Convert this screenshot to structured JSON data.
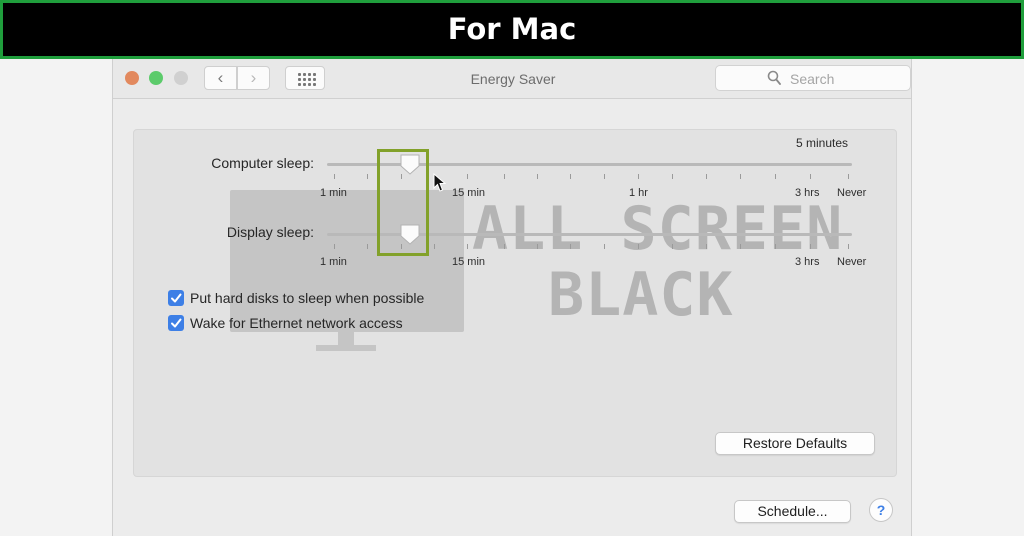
{
  "banner": {
    "title": "For Mac"
  },
  "window": {
    "title": "Energy Saver",
    "search_placeholder": "Search",
    "nav": {
      "back_glyph": "‹",
      "forward_glyph": "›"
    }
  },
  "sliders": {
    "computer_sleep": {
      "label": "Computer sleep:",
      "value_text": "5 minutes",
      "value_fraction": 0.148,
      "tick_labels": {
        "min": "1 min",
        "q": "15 min",
        "hr": "1 hr",
        "three": "3 hrs",
        "never": "Never"
      }
    },
    "display_sleep": {
      "label": "Display sleep:",
      "value_fraction": 0.148,
      "tick_labels": {
        "min": "1 min",
        "q": "15 min",
        "three": "3 hrs",
        "never": "Never"
      }
    }
  },
  "options": {
    "hard_disks": {
      "label": "Put hard disks to sleep when possible",
      "checked": true
    },
    "ethernet": {
      "label": "Wake for Ethernet network access",
      "checked": true
    }
  },
  "buttons": {
    "restore": "Restore Defaults",
    "schedule": "Schedule...",
    "help": "?"
  },
  "watermark": {
    "line1": "ALL SCREEN",
    "line2": "BLACK"
  },
  "icons": [
    "close-light",
    "minimize-light",
    "zoom-light",
    "back-icon",
    "forward-icon",
    "grid-icon",
    "search-icon",
    "slider-thumb",
    "checkmark-icon",
    "pointer-cursor-icon",
    "help-icon"
  ],
  "colors": {
    "banner_border": "#1f9e3c",
    "highlight": "#82a12a",
    "checkbox": "#3d7fe6"
  }
}
